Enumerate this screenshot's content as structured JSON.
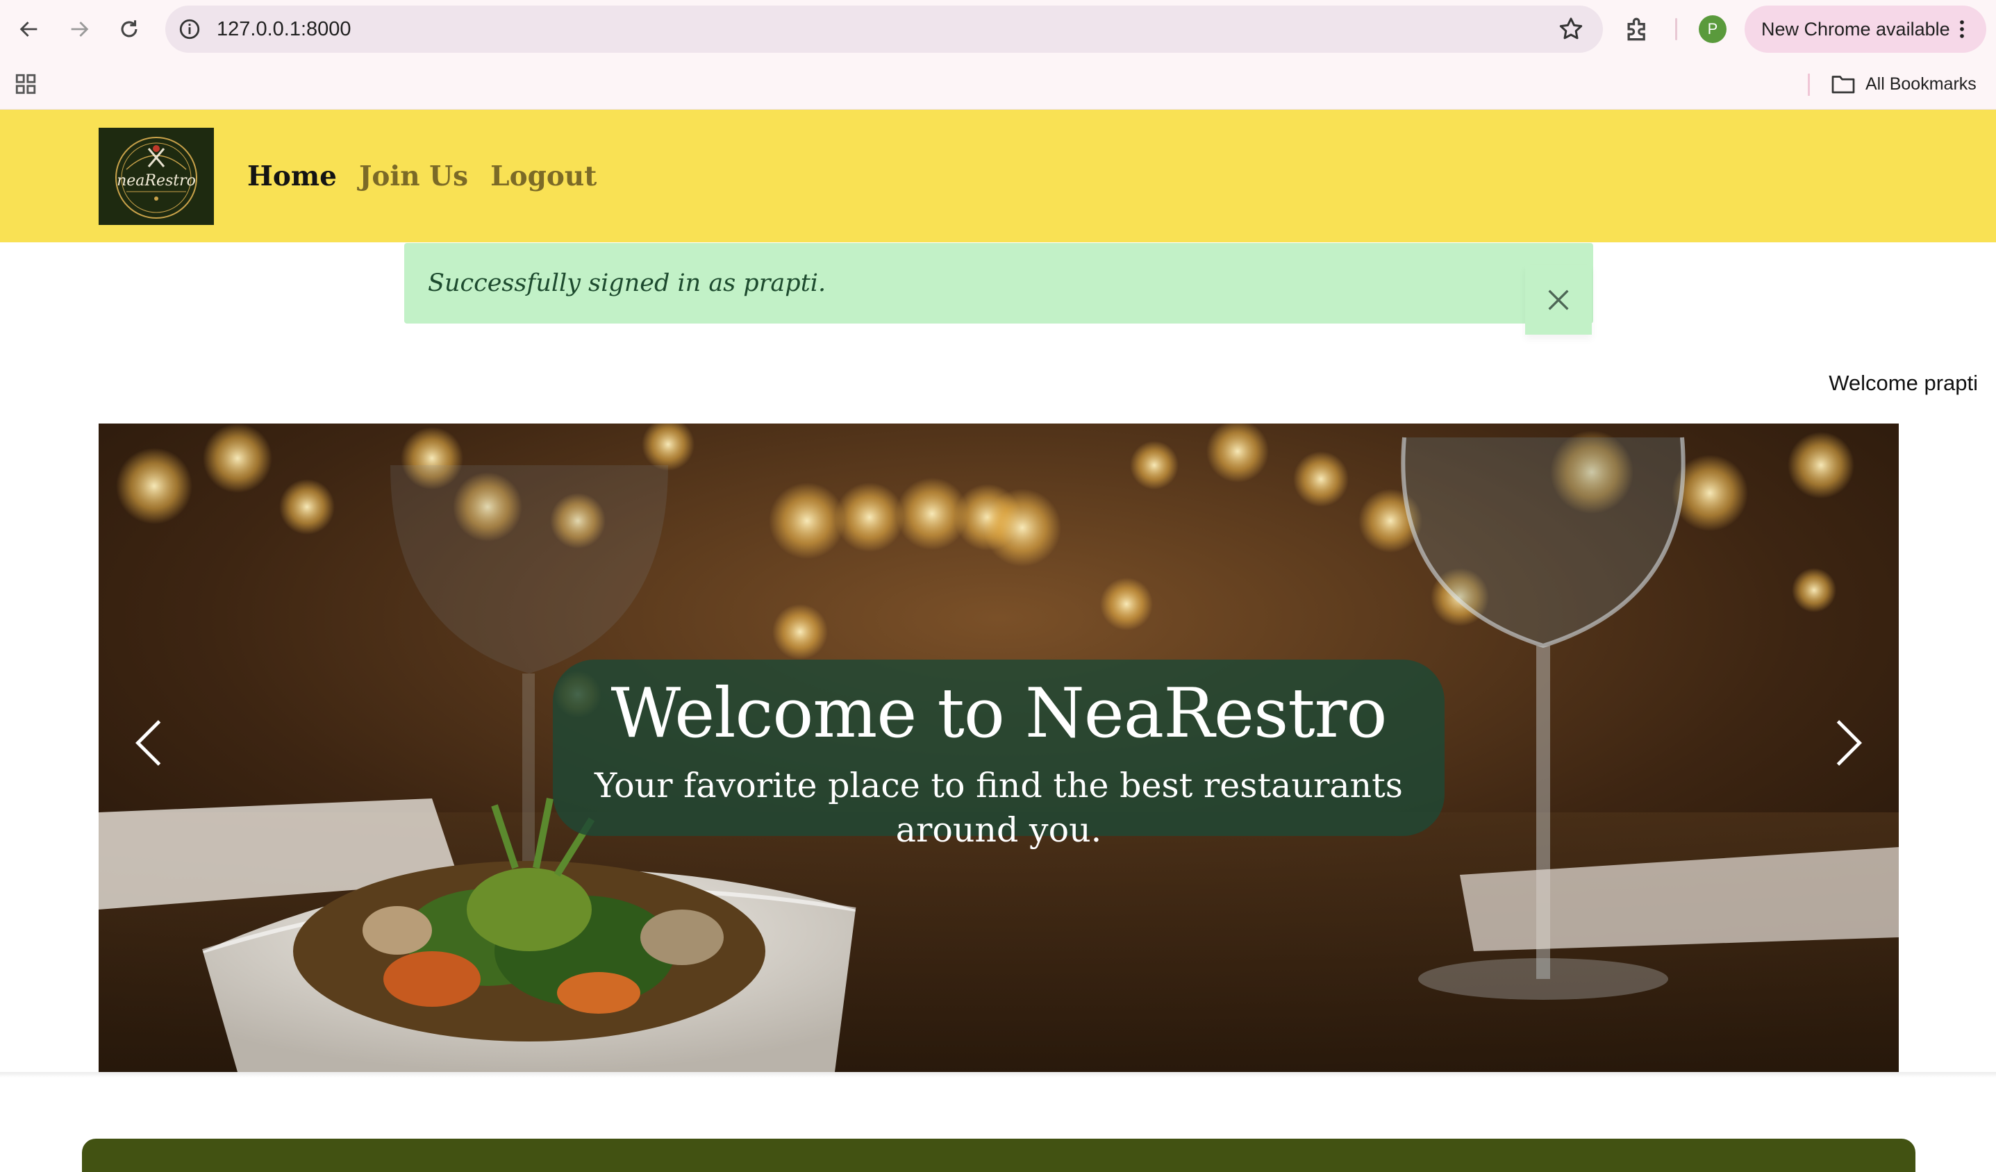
{
  "browser": {
    "url": "127.0.0.1:8000",
    "update_label": "New Chrome available",
    "profile_initial": "P",
    "bookmarks_label": "All Bookmarks",
    "icons": [
      "back-icon",
      "forward-icon",
      "reload-icon",
      "info-icon",
      "star-icon",
      "extensions-icon",
      "more-icon",
      "apps-icon",
      "folder-icon"
    ]
  },
  "site": {
    "logo_text": "neaRestro",
    "nav": [
      {
        "label": "Home"
      },
      {
        "label": "Join Us"
      },
      {
        "label": "Logout"
      }
    ]
  },
  "alert": {
    "message": "Successfully signed in as prapti."
  },
  "user": {
    "welcome": "Welcome prapti"
  },
  "carousel": {
    "title": "Welcome to NeaRestro",
    "subtitle": "Your favorite place to find the best restaurants around you."
  },
  "colors": {
    "header_bg": "#f9e154",
    "nav_active": "#141414",
    "nav_inactive": "#7b6a27",
    "alert_bg": "#c2f1c7",
    "caption_bg": "#1e4834",
    "section_green": "#425212"
  }
}
